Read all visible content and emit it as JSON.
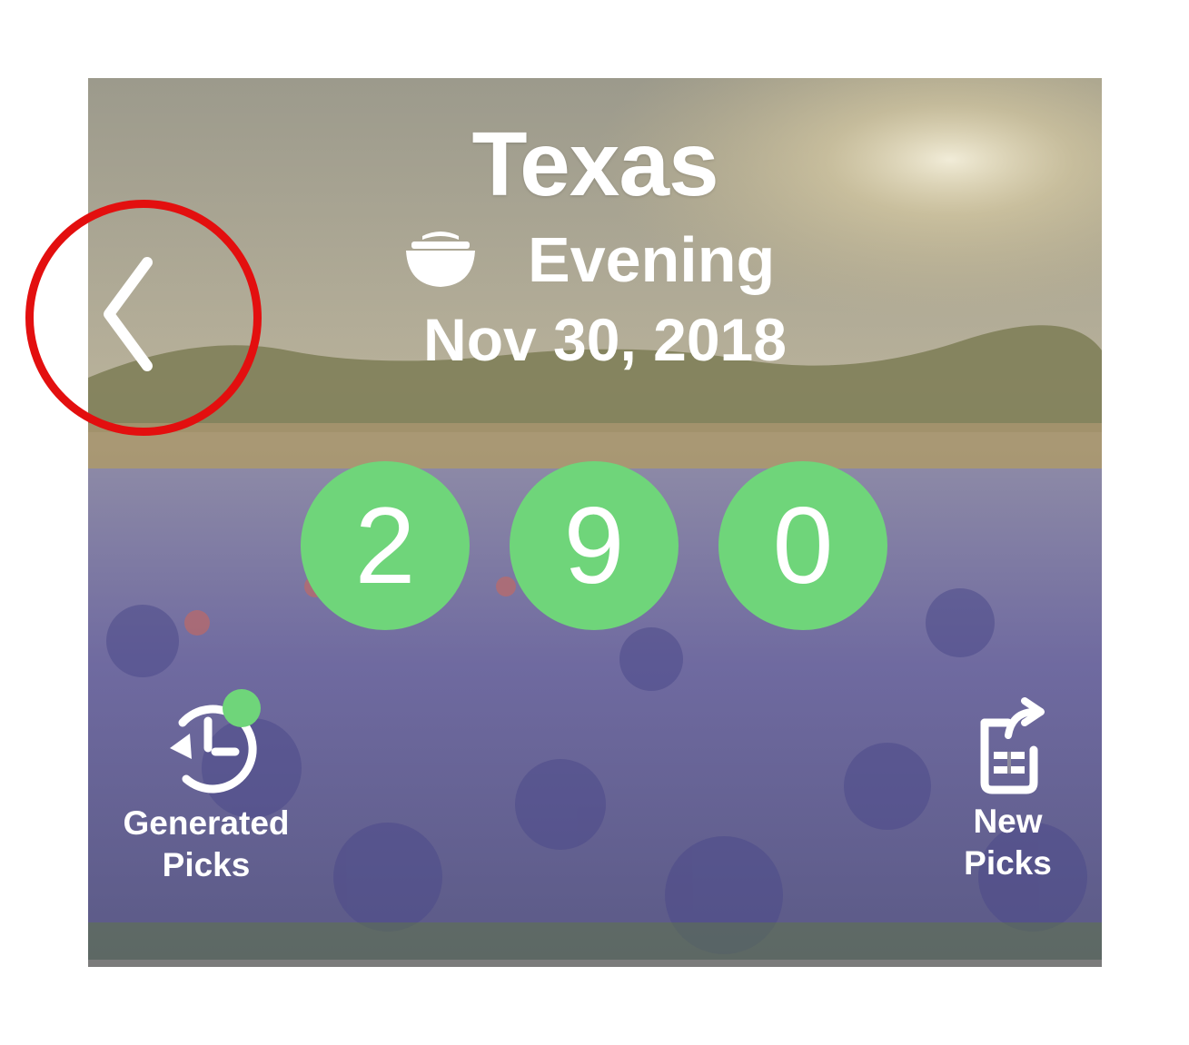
{
  "header": {
    "state": "Texas",
    "draw": "Evening",
    "date": "Nov 30, 2018"
  },
  "numbers": [
    "2",
    "9",
    "0"
  ],
  "actions": {
    "generated_line1": "Generated",
    "generated_line2": "Picks",
    "new_line1": "New",
    "new_line2": "Picks"
  },
  "icons": {
    "back": "chevron-left-icon",
    "draw": "cooking-pot-icon",
    "generated": "history-clock-icon",
    "new": "share-ticket-icon"
  },
  "colors": {
    "ball": "#6fd57a",
    "highlight": "#e30f0f",
    "text": "#ffffff"
  }
}
